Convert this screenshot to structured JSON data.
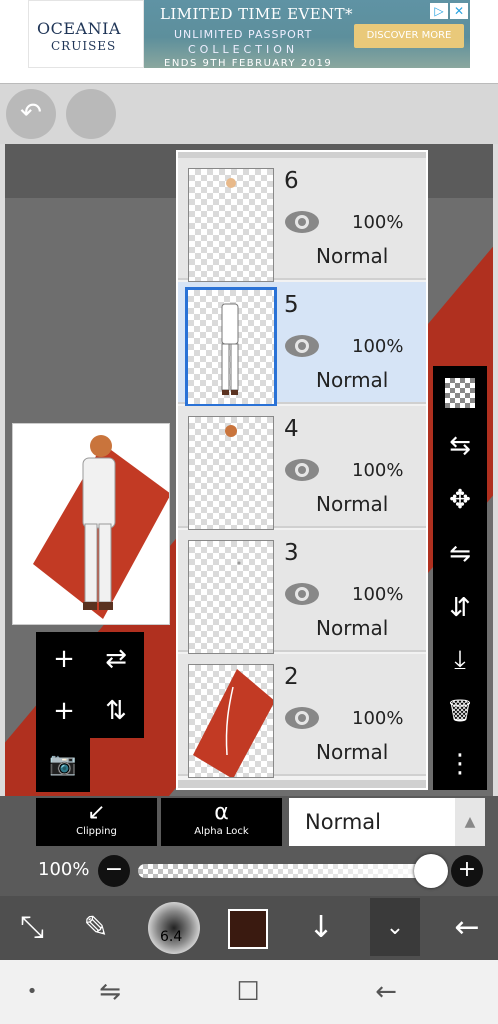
{
  "ad": {
    "brand_line1": "OCEANIA",
    "brand_line2": "CRUISES",
    "headline": "LIMITED TIME EVENT*",
    "line2": "UNLIMITED PASSPORT",
    "line3": "COLLECTION",
    "line4": "ENDS 9TH FEBRUARY 2019",
    "cta": "DISCOVER MORE",
    "info_icon": "▷",
    "close_icon": "✕"
  },
  "topbar": {
    "undo_icon": "↶"
  },
  "layers": [
    {
      "number": "6",
      "opacity": "100%",
      "mode": "Normal",
      "selected": false
    },
    {
      "number": "5",
      "opacity": "100%",
      "mode": "Normal",
      "selected": true
    },
    {
      "number": "4",
      "opacity": "100%",
      "mode": "Normal",
      "selected": false
    },
    {
      "number": "3",
      "opacity": "100%",
      "mode": "Normal",
      "selected": false
    },
    {
      "number": "2",
      "opacity": "100%",
      "mode": "Normal",
      "selected": false
    }
  ],
  "left_tools": {
    "add": "+",
    "flip_h": "⇄",
    "add_layer": "+",
    "flip_v": "⇅",
    "camera": "📷"
  },
  "right_tools": {
    "move": "✥",
    "flip": "⇋",
    "flip_v": "⇵",
    "merge_down": "⤓",
    "delete": "🗑",
    "more": "⋮",
    "swap": "⇆"
  },
  "bottom": {
    "clipping_icon": "↙",
    "clipping_label": "Clipping",
    "alpha_lock_icon": "α",
    "alpha_lock_label": "Alpha Lock",
    "blend_mode": "Normal",
    "blend_arrow": "▲",
    "opacity_label": "100%",
    "opacity_value": 1.0,
    "minus": "−",
    "plus": "+"
  },
  "main_toolbar": {
    "transform_icon": "⤡",
    "brush_icon": "✎",
    "brush_size": "6.4",
    "color": "#3a1a10",
    "down_icon": "↓",
    "layers_toggle_icon": "⌄",
    "back_icon": "←"
  },
  "navbar": {
    "dot": "•",
    "recents": "⇋",
    "home": "☐",
    "back": "←"
  }
}
